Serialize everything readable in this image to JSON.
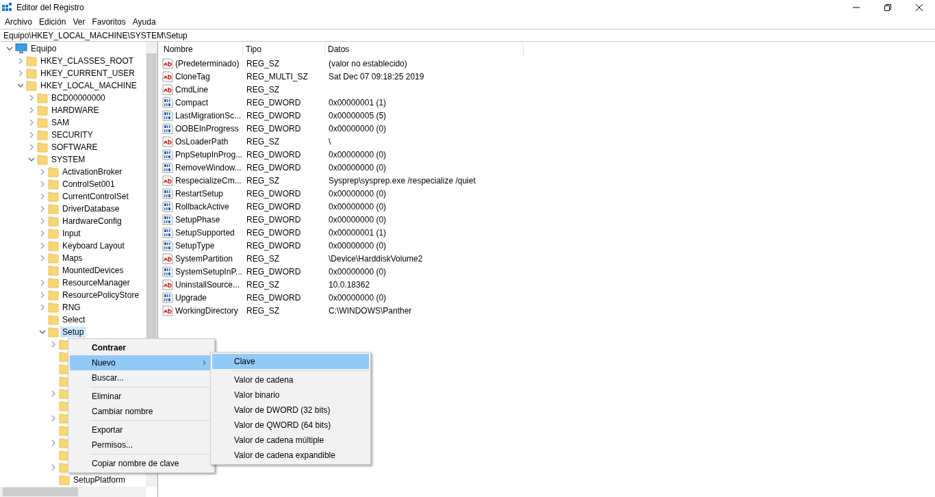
{
  "window": {
    "title": "Editor del Registro"
  },
  "menu_bar": [
    "Archivo",
    "Edición",
    "Ver",
    "Favoritos",
    "Ayuda"
  ],
  "address_bar": {
    "value": "Equipo\\HKEY_LOCAL_MACHINE\\SYSTEM\\Setup"
  },
  "tree": [
    {
      "label": "Equipo",
      "kind": "computer",
      "expanded": true,
      "selected": false,
      "children": [
        {
          "label": "HKEY_CLASSES_ROOT",
          "expanded": false,
          "selected": false
        },
        {
          "label": "HKEY_CURRENT_USER",
          "expanded": false,
          "selected": false
        },
        {
          "label": "HKEY_LOCAL_MACHINE",
          "expanded": true,
          "selected": false,
          "children": [
            {
              "label": "BCD00000000",
              "expanded": false,
              "selected": false
            },
            {
              "label": "HARDWARE",
              "expanded": false,
              "selected": false
            },
            {
              "label": "SAM",
              "expanded": false,
              "selected": false
            },
            {
              "label": "SECURITY",
              "expanded": false,
              "selected": false
            },
            {
              "label": "SOFTWARE",
              "expanded": false,
              "selected": false
            },
            {
              "label": "SYSTEM",
              "expanded": true,
              "selected": false,
              "children": [
                {
                  "label": "ActivationBroker",
                  "expanded": false,
                  "selected": false
                },
                {
                  "label": "ControlSet001",
                  "expanded": false,
                  "selected": false
                },
                {
                  "label": "CurrentControlSet",
                  "expanded": false,
                  "selected": false
                },
                {
                  "label": "DriverDatabase",
                  "expanded": false,
                  "selected": false
                },
                {
                  "label": "HardwareConfig",
                  "expanded": false,
                  "selected": false
                },
                {
                  "label": "Input",
                  "expanded": false,
                  "selected": false
                },
                {
                  "label": "Keyboard Layout",
                  "expanded": false,
                  "selected": false
                },
                {
                  "label": "Maps",
                  "expanded": false,
                  "selected": false
                },
                {
                  "label": "MountedDevices",
                  "selected": false
                },
                {
                  "label": "ResourceManager",
                  "expanded": false,
                  "selected": false
                },
                {
                  "label": "ResourcePolicyStore",
                  "expanded": false,
                  "selected": false
                },
                {
                  "label": "RNG",
                  "expanded": false,
                  "selected": false
                },
                {
                  "label": "Select",
                  "selected": false
                },
                {
                  "label": "Setup",
                  "expanded": true,
                  "selected": true,
                  "children": [
                    {
                      "expandable": true,
                      "expanded": false
                    },
                    {
                      "expandable": false
                    },
                    {
                      "expandable": false
                    },
                    {
                      "expandable": false
                    },
                    {
                      "expandable": true,
                      "expanded": false
                    },
                    {
                      "expandable": false
                    },
                    {
                      "expandable": true,
                      "expanded": false
                    },
                    {
                      "expandable": false
                    },
                    {
                      "expandable": true,
                      "expanded": false
                    },
                    {
                      "expandable": false
                    },
                    {
                      "expandable": true,
                      "expanded": false
                    },
                    {
                      "label": "SetupPlatform",
                      "selected": false
                    }
                  ]
                }
              ]
            }
          ]
        }
      ]
    }
  ],
  "table": {
    "columns": [
      "Nombre",
      "Tipo",
      "Datos"
    ],
    "rows": [
      {
        "kind": "string",
        "name": "(Predeterminado)",
        "type": "REG_SZ",
        "data": "(valor no establecido)"
      },
      {
        "kind": "string",
        "name": "CloneTag",
        "type": "REG_MULTI_SZ",
        "data": "Sat Dec 07 09:18:25 2019"
      },
      {
        "kind": "string",
        "name": "CmdLine",
        "type": "REG_SZ"
      },
      {
        "kind": "binary",
        "name": "Compact",
        "type": "REG_DWORD",
        "data": "0x00000001 (1)"
      },
      {
        "kind": "binary",
        "name": "LastMigrationSc...",
        "type": "REG_DWORD",
        "data": "0x00000005 (5)"
      },
      {
        "kind": "binary",
        "name": "OOBEInProgress",
        "type": "REG_DWORD",
        "data": "0x00000000 (0)"
      },
      {
        "kind": "string",
        "name": "OsLoaderPath",
        "type": "REG_SZ",
        "data": "\\"
      },
      {
        "kind": "binary",
        "name": "PnpSetupInProg...",
        "type": "REG_DWORD",
        "data": "0x00000000 (0)"
      },
      {
        "kind": "binary",
        "name": "RemoveWindow...",
        "type": "REG_DWORD",
        "data": "0x00000000 (0)"
      },
      {
        "kind": "string",
        "name": "RespecializeCm...",
        "type": "REG_SZ",
        "data": "Sysprep\\sysprep.exe /respecialize /quiet"
      },
      {
        "kind": "binary",
        "name": "RestartSetup",
        "type": "REG_DWORD",
        "data": "0x00000000 (0)"
      },
      {
        "kind": "binary",
        "name": "RollbackActive",
        "type": "REG_DWORD",
        "data": "0x00000000 (0)"
      },
      {
        "kind": "binary",
        "name": "SetupPhase",
        "type": "REG_DWORD",
        "data": "0x00000000 (0)"
      },
      {
        "kind": "binary",
        "name": "SetupSupported",
        "type": "REG_DWORD",
        "data": "0x00000001 (1)"
      },
      {
        "kind": "binary",
        "name": "SetupType",
        "type": "REG_DWORD",
        "data": "0x00000000 (0)"
      },
      {
        "kind": "string",
        "name": "SystemPartition",
        "type": "REG_SZ",
        "data": "\\Device\\HarddiskVolume2"
      },
      {
        "kind": "binary",
        "name": "SystemSetupInP...",
        "type": "REG_DWORD",
        "data": "0x00000000 (0)"
      },
      {
        "kind": "string",
        "name": "UninstallSource...",
        "type": "REG_SZ",
        "data": "10.0.18362"
      },
      {
        "kind": "binary",
        "name": "Upgrade",
        "type": "REG_DWORD",
        "data": "0x00000000 (0)"
      },
      {
        "kind": "string",
        "name": "WorkingDirectory",
        "type": "REG_SZ",
        "data": "C:\\WINDOWS\\Panther"
      }
    ]
  },
  "context_menu": {
    "groups": [
      [
        {
          "label": "Contraer",
          "default": true,
          "selected": false,
          "submenu": false
        },
        {
          "label": "Nuevo",
          "default": false,
          "selected": true,
          "submenu": true
        },
        {
          "label": "Buscar...",
          "default": false,
          "selected": false,
          "submenu": false
        }
      ],
      [
        {
          "label": "Eliminar",
          "default": false,
          "selected": false,
          "submenu": false
        },
        {
          "label": "Cambiar nombre",
          "default": false,
          "selected": false,
          "submenu": false
        }
      ],
      [
        {
          "label": "Exportar",
          "default": false,
          "selected": false,
          "submenu": false
        },
        {
          "label": "Permisos...",
          "default": false,
          "selected": false,
          "submenu": false
        }
      ],
      [
        {
          "label": "Copiar nombre de clave",
          "default": false,
          "selected": false,
          "submenu": false
        }
      ]
    ]
  },
  "submenu": {
    "groups": [
      [
        {
          "label": "Clave",
          "selected": true
        }
      ],
      [
        {
          "label": "Valor de cadena",
          "selected": false
        },
        {
          "label": "Valor binario",
          "selected": false
        },
        {
          "label": "Valor de DWORD (32 bits)",
          "selected": false
        },
        {
          "label": "Valor de QWORD (64 bits)",
          "selected": false
        },
        {
          "label": "Valor de cadena múltiple",
          "selected": false
        },
        {
          "label": "Valor de cadena expandible",
          "selected": false
        }
      ]
    ]
  }
}
